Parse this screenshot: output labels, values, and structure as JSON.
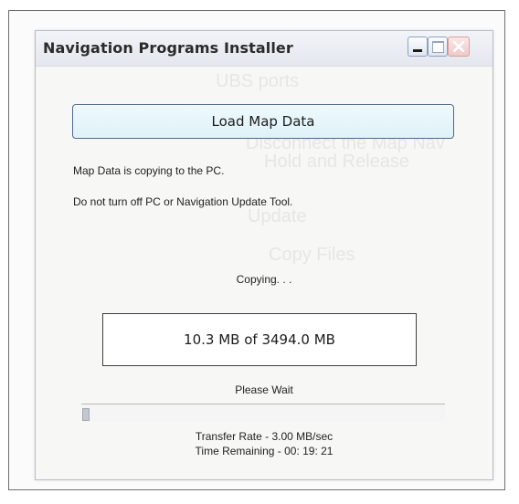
{
  "window": {
    "title": "Navigation Programs Installer"
  },
  "background_text": {
    "line1": "UBS ports",
    "line2": "Disconnect the Map Nav",
    "line3": "Hold and Release",
    "line4": "Update",
    "line5": "Copy Files"
  },
  "main": {
    "load_button_label": "Load Map Data",
    "message_copying": "Map Data is copying to the PC.",
    "message_warning": "Do not turn off PC or Navigation Update Tool.",
    "status_copying": "Copying. . .",
    "transfer_amount": "10.3 MB of 3494.0 MB",
    "status_wait": "Please Wait",
    "progress_fraction": 0.003,
    "transfer_rate": "Transfer Rate - 3.00 MB/sec",
    "time_remaining": "Time Remaining - 00: 19: 21"
  },
  "icons": {
    "minimize": "minimize-icon",
    "maximize": "maximize-icon",
    "close": "close-icon"
  },
  "colors": {
    "button_fill": "#dff2f8",
    "button_border": "#4d6b8f",
    "close_tint": "#f0c8c8"
  }
}
